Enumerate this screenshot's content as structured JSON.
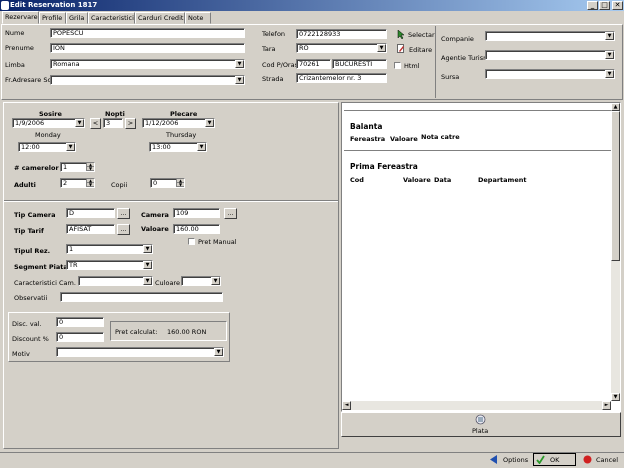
{
  "window": {
    "title": "Edit Reservation 1817",
    "min": "_",
    "max": "□",
    "close": "✕"
  },
  "tabs": [
    "Rezervare",
    "Profile",
    "Grila",
    "Caracteristici",
    "Carduri Credit",
    "Note"
  ],
  "client": {
    "nume_label": "Nume",
    "nume": "POPESCU",
    "prenume_label": "Prenume",
    "prenume": "ION",
    "limba_label": "Limba",
    "limba": "Romana",
    "fradresare_label": "Fr.Adresare Sc",
    "telefon_label": "Telefon",
    "telefon": "0722128933",
    "tara_label": "Tara",
    "tara": "RO",
    "codoras_label": "Cod P/Oras",
    "cod": "70261",
    "oras": "BUCURESTI",
    "strada_label": "Strada",
    "strada": "Crizantemelor nr. 3",
    "selectare": "Selectare",
    "editare": "Editare",
    "html": "Html",
    "companie_label": "Companie",
    "agentie_label": "Agentie Turism",
    "sursa_label": "Sursa"
  },
  "stay": {
    "sosire_label": "Sosire",
    "sosire": "1/9/2006",
    "sosire_day": "Monday",
    "sosire_time": "12:00",
    "nopti_label": "Nopti",
    "nopti": "3",
    "prev": "<",
    "next": ">",
    "plecare_label": "Plecare",
    "plecare": "1/12/2006",
    "plecare_day": "Thursday",
    "plecare_time": "13:00",
    "camere_label": "# camerelor",
    "camere": "1",
    "adulti_label": "Adulti",
    "adulti": "2",
    "copii_label": "Copii",
    "copii": "0"
  },
  "room": {
    "tip_camera_label": "Tip Camera",
    "tip_camera": "D",
    "camera_label": "Camera",
    "camera": "109",
    "tip_tarif_label": "Tip Tarif",
    "tip_tarif": "AFISAT",
    "valoare_label": "Valoare",
    "valoare": "160.00",
    "pret_manual": "Pret Manual",
    "tipul_rez_label": "Tipul Rez.",
    "tipul_rez": "1",
    "segment_label": "Segment Piata",
    "segment": "TR",
    "caract_label": "Caracteristici Cam.",
    "culoare_label": "Culoare",
    "observatii_label": "Observatii",
    "dots": "..."
  },
  "discount": {
    "disc_val_label": "Disc. val.",
    "disc_val": "0",
    "disc_pct_label": "Discount %",
    "disc_pct": "0",
    "motiv_label": "Motiv",
    "pret_calculat_label": "Pret calculat:",
    "pret_calculat": "160.00 RON"
  },
  "balance": {
    "title": "Balanta",
    "cols": [
      "Fereastra",
      "Valoare",
      "Nota catre"
    ],
    "prima": "Prima Fereastra",
    "cols2": [
      "Cod",
      "Valoare",
      "Data",
      "Departament"
    ],
    "plata": "Plata"
  },
  "footer": {
    "options": "Options",
    "ok": "OK",
    "cancel": "Cancel"
  },
  "colors": {
    "title_start": "#0a246a",
    "title_end": "#a6caf0",
    "face": "#d4d0c8"
  }
}
